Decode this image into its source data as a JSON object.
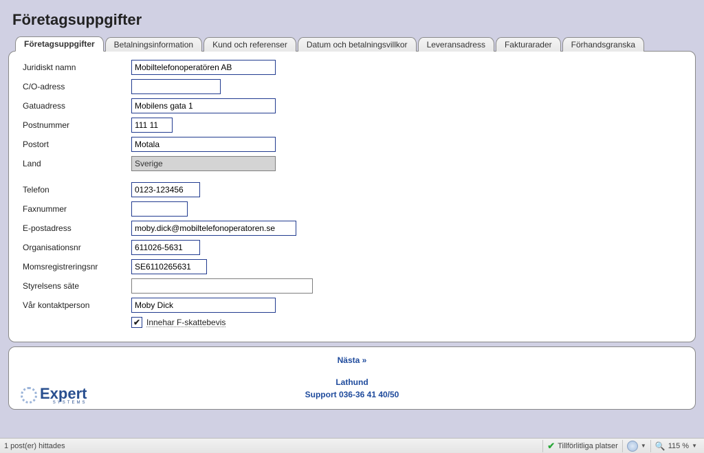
{
  "page": {
    "title": "Företagsuppgifter"
  },
  "tabs": [
    "Företagsuppgifter",
    "Betalningsinformation",
    "Kund och referenser",
    "Datum och betalningsvillkor",
    "Leveransadress",
    "Fakturarader",
    "Förhandsgranska"
  ],
  "labels": {
    "juridiskt_namn": "Juridiskt namn",
    "co_adress": "C/O-adress",
    "gatuadress": "Gatuadress",
    "postnummer": "Postnummer",
    "postort": "Postort",
    "land": "Land",
    "telefon": "Telefon",
    "faxnummer": "Faxnummer",
    "epostadress": "E-postadress",
    "organisationsnr": "Organisationsnr",
    "momsregistreringsnr": "Momsregistreringsnr",
    "styrelsens_sate": "Styrelsens säte",
    "var_kontaktperson": "Vår kontaktperson",
    "checkbox_fskatt": "Innehar F-skattebevis"
  },
  "values": {
    "juridiskt_namn": "Mobiltelefonoperatören AB",
    "co_adress": "",
    "gatuadress": "Mobilens gata 1",
    "postnummer": "111 11",
    "postort": "Motala",
    "land": "Sverige",
    "telefon": "0123-123456",
    "faxnummer": "",
    "epostadress": "moby.dick@mobiltelefonoperatoren.se",
    "organisationsnr": "611026-5631",
    "momsregistreringsnr": "SE6110265631",
    "styrelsens_sate": "",
    "var_kontaktperson": "Moby Dick",
    "checkbox_fskatt_checked": "✔"
  },
  "footer": {
    "next": "Nästa »",
    "guide": "Lathund",
    "support": "Support 036-36 41 40/50",
    "logo_main": "Expert",
    "logo_sub": "SYSTEMS"
  },
  "statusbar": {
    "left": "1 post(er) hittades",
    "site": "Tillförlitliga platser",
    "zoom": "115 %"
  }
}
